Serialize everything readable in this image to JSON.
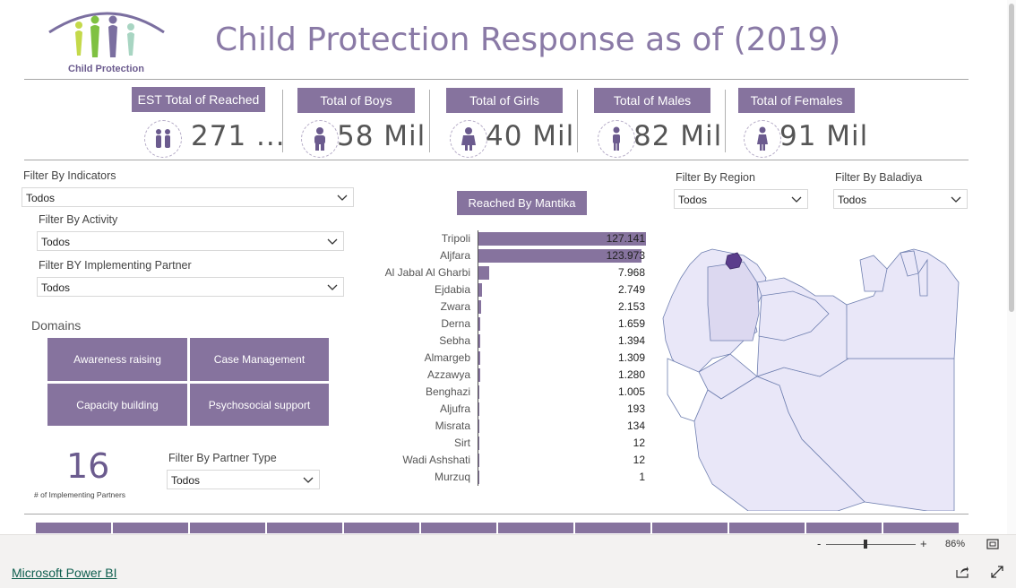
{
  "logo": {
    "caption": "Child Protection"
  },
  "title": "Child Protection Response as of (2019)",
  "kpis": [
    {
      "label": "EST Total of Reached",
      "value": "271 ...",
      "icon": "two-children-icon"
    },
    {
      "label": "Total of Boys",
      "value": "58 Mil",
      "icon": "boy-icon"
    },
    {
      "label": "Total of Girls",
      "value": "40 Mil",
      "icon": "girl-icon"
    },
    {
      "label": "Total of Males",
      "value": "82 Mil",
      "icon": "man-icon"
    },
    {
      "label": "Total of Females",
      "value": "91 Mil",
      "icon": "woman-icon"
    }
  ],
  "filters": {
    "indicators": {
      "label": "Filter By Indicators",
      "value": "Todos"
    },
    "activity": {
      "label": "Filter By Activity",
      "value": "Todos"
    },
    "partner": {
      "label": "Filter BY Implementing Partner",
      "value": "Todos"
    },
    "region": {
      "label": "Filter By Region",
      "value": "Todos"
    },
    "baladiya": {
      "label": "Filter By Baladiya",
      "value": "Todos"
    },
    "partner_type": {
      "label": "Filter By Partner Type",
      "value": "Todos"
    }
  },
  "domains": {
    "heading": "Domains",
    "buttons": [
      "Awareness raising",
      "Case Management",
      "Capacity building",
      "Psychosocial support"
    ]
  },
  "partners_card": {
    "value": "16",
    "label": "# of Implementing Partners"
  },
  "chart_data": {
    "type": "bar",
    "orientation": "horizontal",
    "title": "Reached By Mantika",
    "categories": [
      "Tripoli",
      "Aljfara",
      "Al Jabal Al Gharbi",
      "Ejdabia",
      "Zwara",
      "Derna",
      "Sebha",
      "Almargeb",
      "Azzawya",
      "Benghazi",
      "Aljufra",
      "Misrata",
      "Sirt",
      "Wadi Ashshati",
      "Murzuq"
    ],
    "values": [
      127141,
      123973,
      7968,
      2749,
      2153,
      1659,
      1394,
      1309,
      1280,
      1005,
      193,
      134,
      12,
      12,
      1
    ],
    "value_labels": [
      "127.141",
      "123.973",
      "7.968",
      "2.749",
      "2.153",
      "1.659",
      "1.394",
      "1.309",
      "1.280",
      "1.005",
      "193",
      "134",
      "12",
      "12",
      "1"
    ],
    "color": "#86739e"
  },
  "map": {
    "highlight_color": "#5b3d8c",
    "fill_color": "#e6e3f5",
    "border_color": "#6f7fb0"
  },
  "statusbar": {
    "zoom_minus": "-",
    "zoom_plus": "+",
    "zoom": "86%"
  },
  "footer": {
    "link": "Microsoft Power BI"
  },
  "colors": {
    "accent": "#86739e",
    "title": "#8a7aa6"
  }
}
